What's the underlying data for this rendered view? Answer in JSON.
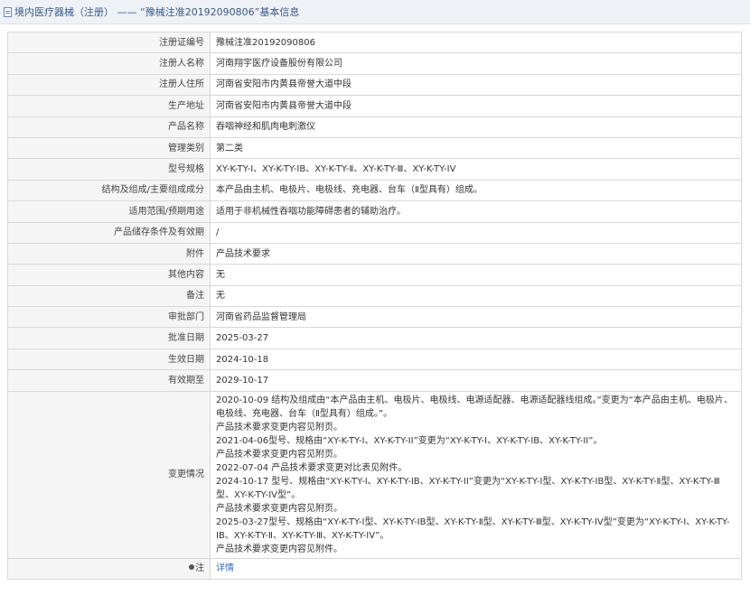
{
  "header": {
    "title": "境内医疗器械（注册） —— “豫械注准20192090806”基本信息"
  },
  "rows": [
    {
      "label": "注册证编号",
      "value": "豫械注准20192090806"
    },
    {
      "label": "注册人名称",
      "value": "河南翔宇医疗设备股份有限公司"
    },
    {
      "label": "注册人住所",
      "value": "河南省安阳市内黄县帝誉大道中段"
    },
    {
      "label": "生产地址",
      "value": "河南省安阳市内黄县帝誉大道中段"
    },
    {
      "label": "产品名称",
      "value": "吞咽神经和肌肉电刺激仪"
    },
    {
      "label": "管理类别",
      "value": "第二类"
    },
    {
      "label": "型号规格",
      "value": "XY-K-TY-Ⅰ、XY-K-TY-ⅠB、XY-K-TY-Ⅱ、XY-K-TY-Ⅲ、XY-K-TY-IV"
    },
    {
      "label": "结构及组成/主要组成成分",
      "value": "本产品由主机、电极片、电极线、充电器、台车（Ⅱ型具有）组成。"
    },
    {
      "label": "适用范围/预期用途",
      "value": "适用于非机械性吞咽功能障碍患者的辅助治疗。"
    },
    {
      "label": "产品储存条件及有效期",
      "value": "/"
    },
    {
      "label": "附件",
      "value": "产品技术要求"
    },
    {
      "label": "其他内容",
      "value": "无"
    },
    {
      "label": "备注",
      "value": "无"
    },
    {
      "label": "审批部门",
      "value": "河南省药品监督管理局"
    },
    {
      "label": "批准日期",
      "value": "2025-03-27"
    },
    {
      "label": "生效日期",
      "value": "2024-10-18"
    },
    {
      "label": "有效期至",
      "value": "2029-10-17"
    }
  ],
  "changes": {
    "label": "变更情况",
    "lines": [
      "2020-10-09 结构及组成由“本产品由主机、电极片、电极线、电源适配器、电源适配器线组成。”变更为“本产品由主机、电极片、电极线、充电器、台车（Ⅱ型具有）组成。”。",
      "产品技术要求变更内容见附页。",
      "2021-04-06型号、规格由“XY-K-TY-I、XY-K-TY-II”变更为“XY-K-TY-I、XY-K-TY-IB、XY-K-TY-II”。",
      "产品技术要求变更内容见附页。",
      "2022-07-04 产品技术要求变更对比表见附件。",
      "2024-10-17 型号、规格由“XY-K-TY-I、XY-K-TY-IB、XY-K-TY-II”变更为“XY-K-TY-I型、XY-K-TY-IB型、XY-K-TY-Ⅱ型、XY-K-TY-Ⅲ型、XY-K-TY-IV型”。",
      "产品技术要求变更内容见附页。",
      "2025-03-27型号、规格由“XY-K-TY-Ⅰ型、XY-K-TY-ⅠB型、XY-K-TY-Ⅱ型、XY-K-TY-Ⅲ型、XY-K-TY-IV型”变更为“XY-K-TY-Ⅰ、XY-K-TY-ⅠB、XY-K-TY-Ⅱ、XY-K-TY-Ⅲ、XY-K-TY-IV”。",
      "产品技术要求变更内容见附件。"
    ]
  },
  "note": {
    "label": "注",
    "link_text": "详情"
  }
}
